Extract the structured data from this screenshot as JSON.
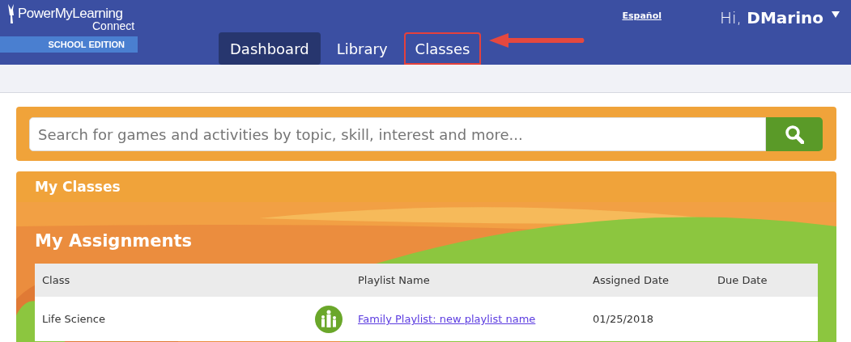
{
  "logo": {
    "name": "PowerMyLearning",
    "product": "Connect",
    "edition": "SCHOOL EDITION"
  },
  "nav": [
    {
      "label": "Dashboard",
      "selected": true,
      "highlighted": false
    },
    {
      "label": "Library",
      "selected": false,
      "highlighted": false
    },
    {
      "label": "Classes",
      "selected": false,
      "highlighted": true
    }
  ],
  "language_link": "Español",
  "user": {
    "greeting": "Hi,",
    "name": "DMarino"
  },
  "search": {
    "placeholder": "Search for games and activities by topic, skill, interest and more..."
  },
  "my_classes": {
    "title": "My Classes"
  },
  "assignments": {
    "title": "My Assignments",
    "columns": [
      "Class",
      "Playlist Name",
      "Assigned Date",
      "Due Date"
    ],
    "rows": [
      {
        "class": "Life Science",
        "playlist": "Family Playlist: new playlist name",
        "assigned": "01/25/2018"
      }
    ]
  }
}
